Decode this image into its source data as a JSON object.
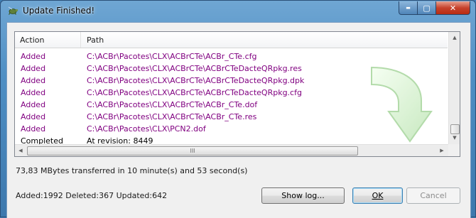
{
  "window": {
    "title": "Update Finished!",
    "controls": {
      "minimize": "▬",
      "maximize": "▢",
      "close": "✕"
    }
  },
  "list": {
    "columns": [
      "Action",
      "Path"
    ],
    "rows": [
      {
        "action": "Added",
        "path": "C:\\ACBr\\Pacotes\\CLX\\ACBrCTe\\ACBr_CTe.cfg",
        "status": "added"
      },
      {
        "action": "Added",
        "path": "C:\\ACBr\\Pacotes\\CLX\\ACBrCTe\\ACBrCTeDacteQRpkg.res",
        "status": "added"
      },
      {
        "action": "Added",
        "path": "C:\\ACBr\\Pacotes\\CLX\\ACBrCTe\\ACBrCTeDacteQRpkg.dpk",
        "status": "added"
      },
      {
        "action": "Added",
        "path": "C:\\ACBr\\Pacotes\\CLX\\ACBrCTe\\ACBrCTeDacteQRpkg.cfg",
        "status": "added"
      },
      {
        "action": "Added",
        "path": "C:\\ACBr\\Pacotes\\CLX\\ACBrCTe\\ACBr_CTe.dof",
        "status": "added"
      },
      {
        "action": "Added",
        "path": "C:\\ACBr\\Pacotes\\CLX\\ACBrCTe\\ACBr_CTe.res",
        "status": "added"
      },
      {
        "action": "Added",
        "path": "C:\\ACBr\\Pacotes\\CLX\\PCN2.dof",
        "status": "added"
      },
      {
        "action": "Completed",
        "path": "At revision: 8449",
        "status": "done"
      }
    ],
    "colors": {
      "added": "#800080",
      "done": "#000000"
    },
    "hscroll_grip": "III"
  },
  "transfer_text": "73,83 MBytes transferred in 10 minute(s) and 53 second(s)",
  "stats_text": "Added:1992 Deleted:367 Updated:642",
  "buttons": {
    "show_log": "Show log...",
    "ok": "OK",
    "cancel": "Cancel"
  },
  "icons": {
    "app": "tortoise-icon",
    "watermark": "update-arrow-icon"
  },
  "colors": {
    "accent": "#3c7fb1",
    "titlebar": "#4f8fc4"
  }
}
